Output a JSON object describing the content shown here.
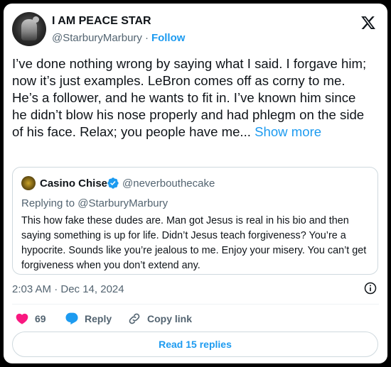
{
  "author": {
    "display_name": "I AM PEACE STAR",
    "handle": "@StarburyMarbury",
    "separator": "·",
    "follow_label": "Follow"
  },
  "tweet": {
    "text": "I’ve done nothing wrong by saying what I said. I forgave him; now it’s just examples. LeBron comes off as corny to me. He’s a follower, and he wants to fit in. I’ve known him since he didn’t blow his nose properly and had phlegm on the side of his face. Relax; you people have me...",
    "show_more_label": "Show more"
  },
  "quote": {
    "display_name": "Casino Chise",
    "handle": "@neverbouthecake",
    "replying_to": "Replying to @StarburyMarbury",
    "text": "This how fake these dudes are. Man got Jesus is real in his bio and then saying something is up for life. Didn’t Jesus teach forgiveness? You’re a hypocrite. Sounds like you’re jealous to me. Enjoy your misery. You can’t get forgiveness when you don’t extend any."
  },
  "timestamp": "2:03 AM · Dec 14, 2024",
  "actions": {
    "like_count": "69",
    "reply_label": "Reply",
    "copy_link_label": "Copy link"
  },
  "read_replies_label": "Read 15 replies",
  "colors": {
    "accent": "#1d9bf0",
    "like": "#f91880",
    "muted": "#536471",
    "text": "#0f1419",
    "verified": "#1d9bf0"
  },
  "icons": [
    "x-logo-icon",
    "verified-badge-icon",
    "info-icon",
    "heart-icon",
    "reply-bubble-icon",
    "link-icon"
  ]
}
